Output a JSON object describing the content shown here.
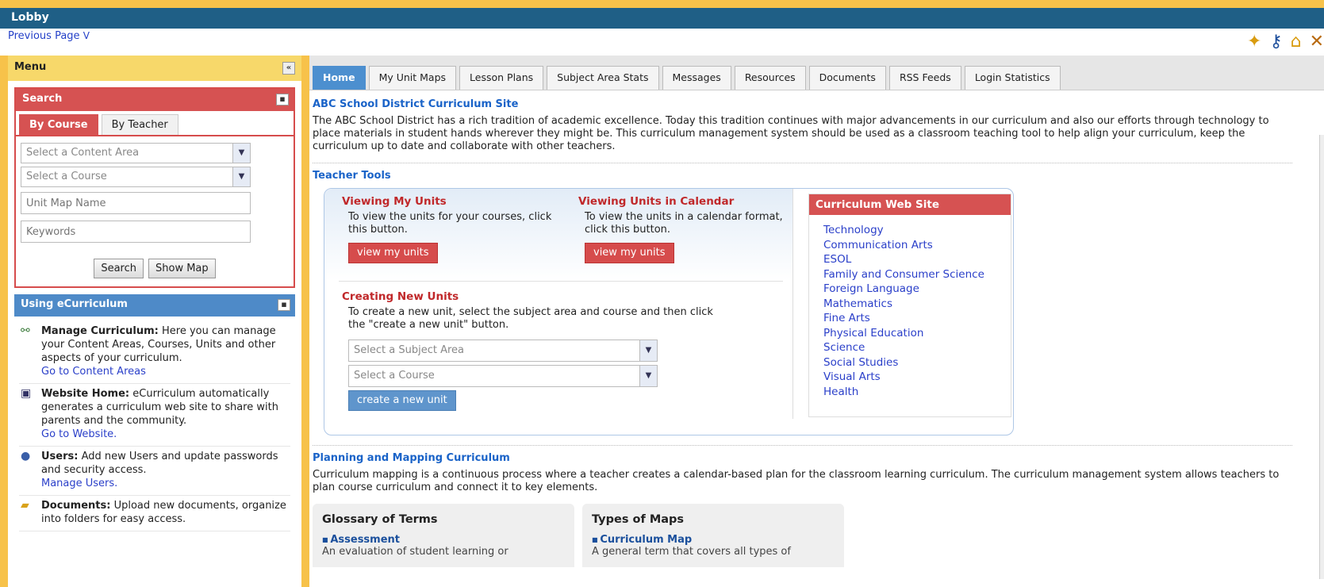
{
  "window": {
    "title": "Lobby"
  },
  "nav": {
    "previous_page": "Previous Page",
    "chevron": "V"
  },
  "top_icons": [
    "puzzle-icon",
    "key-icon",
    "home-icon",
    "close-icon"
  ],
  "sidebar": {
    "menu_title": "Menu",
    "menu_collapse": "«",
    "search": {
      "title": "Search",
      "minimize": "▪",
      "tabs": [
        "By Course",
        "By Teacher"
      ],
      "content_area_placeholder": "Select a Content Area",
      "course_placeholder": "Select a Course",
      "unit_map_placeholder": "Unit Map Name",
      "keywords_placeholder": "Keywords",
      "search_button": "Search",
      "show_map_button": "Show Map"
    },
    "using": {
      "title": "Using eCurriculum",
      "minimize": "▪",
      "items": [
        {
          "title": "Manage Curriculum:",
          "text": "Here you can manage your Content Areas, Courses, Units and other aspects of your curriculum.",
          "link": "Go to Content Areas",
          "icon": "hierarchy-icon"
        },
        {
          "title": "Website Home:",
          "text": "eCurriculum automatically generates a curriculum web site to share with parents and the community.",
          "link": "Go to Website.",
          "icon": "website-icon"
        },
        {
          "title": "Users:",
          "text": "Add new Users and update passwords and security access.",
          "link": "Manage Users.",
          "icon": "user-icon"
        },
        {
          "title": "Documents:",
          "text": "Upload new documents, organize into folders for easy access.",
          "link": "",
          "icon": "folder-icon"
        }
      ]
    }
  },
  "tabs": [
    "Home",
    "My Unit Maps",
    "Lesson Plans",
    "Subject Area Stats",
    "Messages",
    "Resources",
    "Documents",
    "RSS Feeds",
    "Login Statistics"
  ],
  "main": {
    "site_title": "ABC School District Curriculum Site",
    "site_text": "The ABC School District has a rich tradition of academic excellence. Today this tradition continues with major advancements in our curriculum and also our efforts through technology to place materials in student hands wherever they might be. This curriculum management system should be used as a classroom teaching tool to help align your curriculum, keep the curriculum up to date and collaborate with other teachers.",
    "teacher_tools_title": "Teacher Tools",
    "viewing_units": {
      "title": "Viewing My Units",
      "text": "To view the units for your courses, click this button.",
      "button": "view my units"
    },
    "viewing_calendar": {
      "title": "Viewing Units in Calendar",
      "text": "To view the units in a calendar format, click this button.",
      "button": "view my units"
    },
    "creating_units": {
      "title": "Creating New Units",
      "text": "To create a new unit, select the subject area and course and then click the \"create a new unit\" button.",
      "subject_placeholder": "Select a Subject Area",
      "course_placeholder": "Select a Course",
      "button": "create a new unit"
    },
    "curriculum_web_site": {
      "title": "Curriculum Web Site",
      "links": [
        "Technology",
        "Communication Arts",
        "ESOL",
        "Family and Consumer Science",
        "Foreign Language",
        "Mathematics",
        "Fine Arts",
        "Physical Education",
        "Science",
        "Social Studies",
        "Visual Arts",
        "Health"
      ]
    },
    "planning_title": "Planning and Mapping Curriculum",
    "planning_text": "Curriculum mapping is a continuous process where a teacher creates a calendar-based plan for the classroom learning curriculum. The curriculum management system allows teachers to plan course curriculum and connect it to key elements.",
    "glossary": {
      "title": "Glossary of Terms",
      "term": "Assessment",
      "def": "An evaluation of student learning or"
    },
    "types_of_maps": {
      "title": "Types of Maps",
      "term": "Curriculum Map",
      "def": "A general term that covers all types of"
    }
  }
}
